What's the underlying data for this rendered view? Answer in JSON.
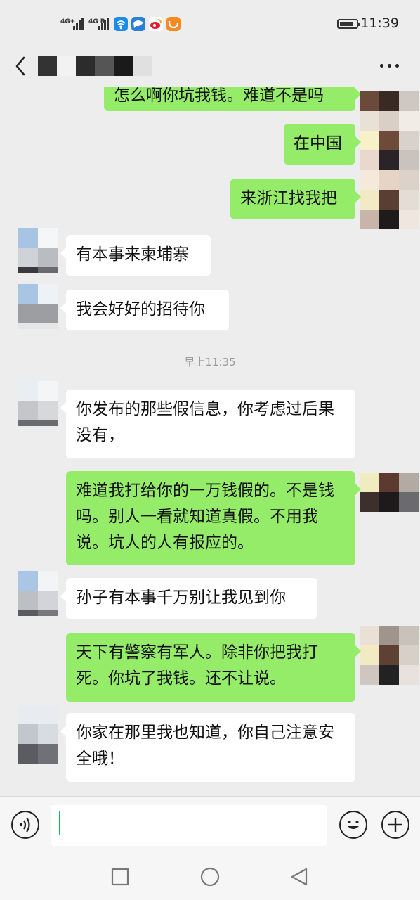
{
  "status_bar": {
    "network_1": "4G+",
    "network_2": "4G R",
    "time": "11:39",
    "icons": [
      "signal-icon",
      "signal-icon",
      "wifi-icon",
      "message-app-icon",
      "weibo-icon",
      "uc-browser-icon",
      "battery-icon"
    ]
  },
  "header": {
    "back_icon": "chevron-left-icon",
    "more_icon": "more-dots-icon"
  },
  "messages": [
    {
      "side": "out",
      "text": "怎么啊你坑我钱。难道不是吗"
    },
    {
      "side": "out",
      "text": "在中国"
    },
    {
      "side": "out",
      "text": "来浙江找我把"
    },
    {
      "side": "in",
      "text": "有本事来柬埔寨"
    },
    {
      "side": "in",
      "text": "我会好好的招待你"
    },
    {
      "side": "in",
      "text": "你发布的那些假信息，你考虑过后果没有，"
    },
    {
      "side": "out",
      "text": "难道我打给你的一万钱假的。不是钱吗。别人一看就知道真假。不用我说。坑人的人有报应的。"
    },
    {
      "side": "in",
      "text": "孙子有本事千万别让我见到你"
    },
    {
      "side": "out",
      "text": "天下有警察有军人。除非你把我打死。你坑了我钱。还不让说。"
    },
    {
      "side": "in",
      "text": "你家在那里我也知道，你自己注意安全哦！"
    }
  ],
  "timestamp": "早上11:35",
  "input": {
    "value": "",
    "voice_icon": "voice-icon",
    "emoji_icon": "emoji-icon",
    "plus_icon": "plus-icon"
  },
  "navigation": {
    "recent_icon": "square-recent-icon",
    "home_icon": "circle-home-icon",
    "back_icon": "triangle-back-icon"
  },
  "colors": {
    "background": "#ededed",
    "outgoing_bubble": "#95ec69",
    "incoming_bubble": "#ffffff",
    "caret": "#07c160"
  }
}
